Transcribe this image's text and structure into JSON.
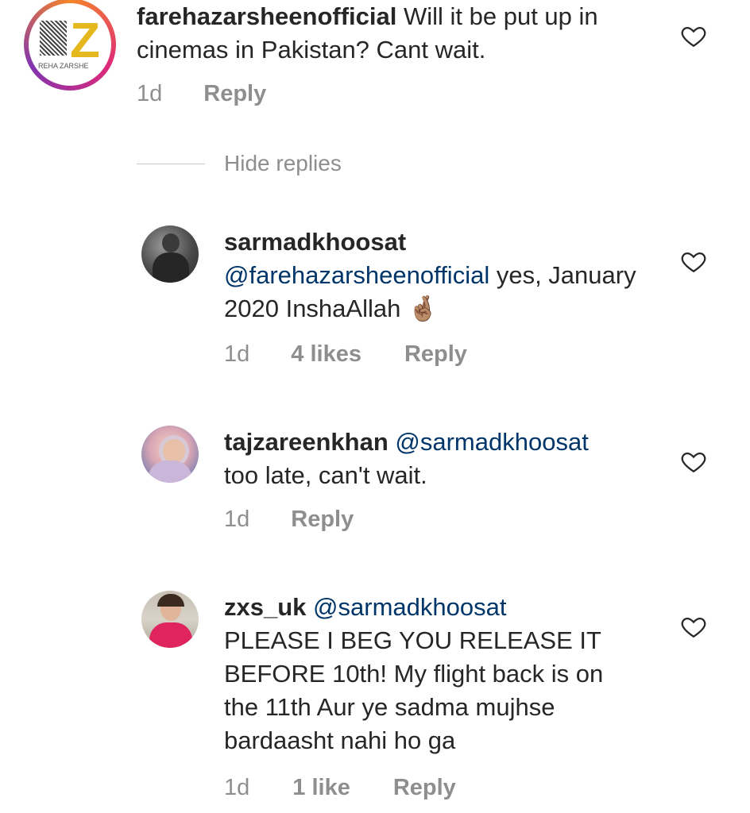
{
  "comments": [
    {
      "username": "farehazarsheenofficial",
      "mention": "",
      "text": " Will it be put up in cinemas in Pakistan? Cant wait.",
      "time": "1d",
      "likes": "",
      "reply_label": "Reply",
      "avatar_logo_text": "Z",
      "avatar_caption": "REHA ZARSHE"
    },
    {
      "username": "sarmadkhoosat",
      "mention": "@farehazarsheenofficial",
      "text": " yes, January 2020 InshaAllah ",
      "emoji": "🤞🏽",
      "time": "1d",
      "likes": "4 likes",
      "reply_label": "Reply"
    },
    {
      "username": "tajzareenkhan",
      "mention": "@sarmadkhoosat",
      "text": "too late, can't wait.",
      "time": "1d",
      "likes": "",
      "reply_label": "Reply"
    },
    {
      "username": "zxs_uk",
      "mention": "@sarmadkhoosat",
      "text": "PLEASE I BEG YOU RELEASE IT BEFORE 10th! My flight back is on the 11th Aur ye sadma mujhse bardaasht nahi ho ga",
      "time": "1d",
      "likes": "1 like",
      "reply_label": "Reply"
    }
  ],
  "hide_replies_label": "Hide replies",
  "colors": {
    "text": "#262626",
    "meta": "#8e8e8e",
    "mention": "#003569",
    "gold": "#e6b820"
  }
}
